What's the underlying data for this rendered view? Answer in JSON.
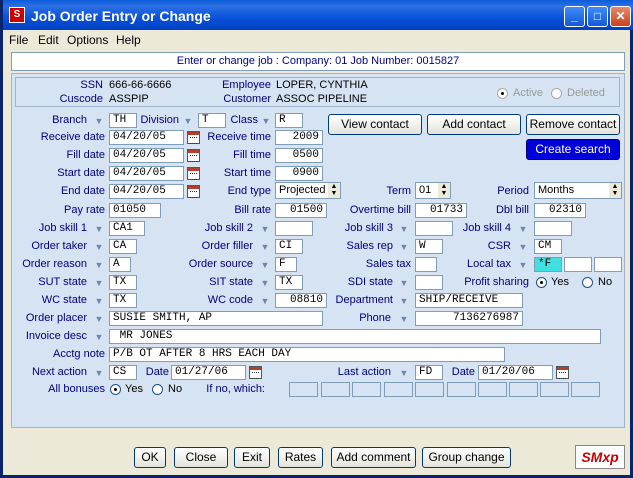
{
  "window": {
    "title": "Job Order Entry or Change",
    "icon_name": "app-icon"
  },
  "menu": [
    "File",
    "Edit",
    "Options",
    "Help"
  ],
  "job_header": "Enter or change job :  Company:  01   Job Number:  0015827",
  "employee": {
    "ssn_label": "SSN",
    "ssn": "666-66-6666",
    "cuscode_label": "Cuscode",
    "cuscode": "ASSPIP",
    "employee_label": "Employee",
    "employee": "LOPER, CYNTHIA",
    "customer_label": "Customer",
    "customer": "ASSOC PIPELINE",
    "active_label": "Active",
    "deleted_label": "Deleted"
  },
  "fields": {
    "branch_label": "Branch",
    "branch": "TH",
    "division_label": "Division",
    "division": "T",
    "class_label": "Class",
    "class": "R",
    "receive_date_label": "Receive date",
    "receive_date": "04/20/05",
    "receive_time_label": "Receive time",
    "receive_time": "2009",
    "fill_date_label": "Fill date",
    "fill_date": "04/20/05",
    "fill_time_label": "Fill time",
    "fill_time": "0500",
    "start_date_label": "Start date",
    "start_date": "04/20/05",
    "start_time_label": "Start time",
    "start_time": "0900",
    "end_date_label": "End date",
    "end_date": "04/20/05",
    "end_type_label": "End type",
    "end_type": "Projected",
    "term_label": "Term",
    "term": "01",
    "period_label": "Period",
    "period": "Months",
    "pay_rate_label": "Pay rate",
    "pay_rate": "01050",
    "bill_rate_label": "Bill rate",
    "bill_rate": "01500",
    "overtime_bill_label": "Overtime bill",
    "overtime_bill": "01733",
    "dbl_bill_label": "Dbl bill",
    "dbl_bill": "02310",
    "job_skill1_label": "Job skill 1",
    "job_skill1": "CA1",
    "job_skill2_label": "Job skill 2",
    "job_skill2": "",
    "job_skill3_label": "Job skill 3",
    "job_skill3": "",
    "job_skill4_label": "Job skill 4",
    "job_skill4": "",
    "order_taker_label": "Order taker",
    "order_taker": "CA",
    "order_filler_label": "Order filler",
    "order_filler": "CI",
    "sales_rep_label": "Sales rep",
    "sales_rep": "W",
    "csr_label": "CSR",
    "csr": "CM",
    "order_reason_label": "Order reason",
    "order_reason": "A",
    "order_source_label": "Order source",
    "order_source": "F",
    "sales_tax_label": "Sales tax",
    "sales_tax": "",
    "local_tax_label": "Local tax",
    "local_tax": "*F",
    "sut_state_label": "SUT state",
    "sut_state": "TX",
    "sit_state_label": "SIT state",
    "sit_state": "TX",
    "sdi_state_label": "SDI state",
    "sdi_state": "",
    "profit_sharing_label": "Profit sharing",
    "yes_label": "Yes",
    "no_label": "No",
    "wc_state_label": "WC state",
    "wc_state": "TX",
    "wc_code_label": "WC code",
    "wc_code": "08810",
    "department_label": "Department",
    "department": "SHIP/RECEIVE",
    "order_placer_label": "Order placer",
    "order_placer": "SUSIE SMITH, AP",
    "phone_label": "Phone",
    "phone": "7136276987",
    "invoice_desc_label": "Invoice desc",
    "invoice_desc": " MR JONES",
    "acctg_note_label": "Acctg note",
    "acctg_note": "P/B OT AFTER 8 HRS EACH DAY",
    "next_action_label": "Next action",
    "next_action": "CS",
    "date_label": "Date",
    "next_date": "01/27/06",
    "last_action_label": "Last action",
    "last_action": "FD",
    "last_date": "01/20/06",
    "all_bonuses_label": "All bonuses",
    "if_no_label": "If no, which:"
  },
  "side_buttons": {
    "view_contact": "View contact",
    "add_contact": "Add contact",
    "remove_contact": "Remove contact",
    "create_search": "Create search"
  },
  "bottom_buttons": {
    "ok": "OK",
    "close": "Close",
    "exit": "Exit",
    "rates": "Rates",
    "add_comment": "Add comment",
    "group_change": "Group change"
  },
  "logo_text": "SMxp",
  "colors": {
    "title_blue": "#0A5CDA",
    "panel_bg": "#D6E3F2",
    "label_text": "#00007A",
    "create_search_bg": "#0000D8",
    "local_tax_highlight": "#40E0E0"
  }
}
